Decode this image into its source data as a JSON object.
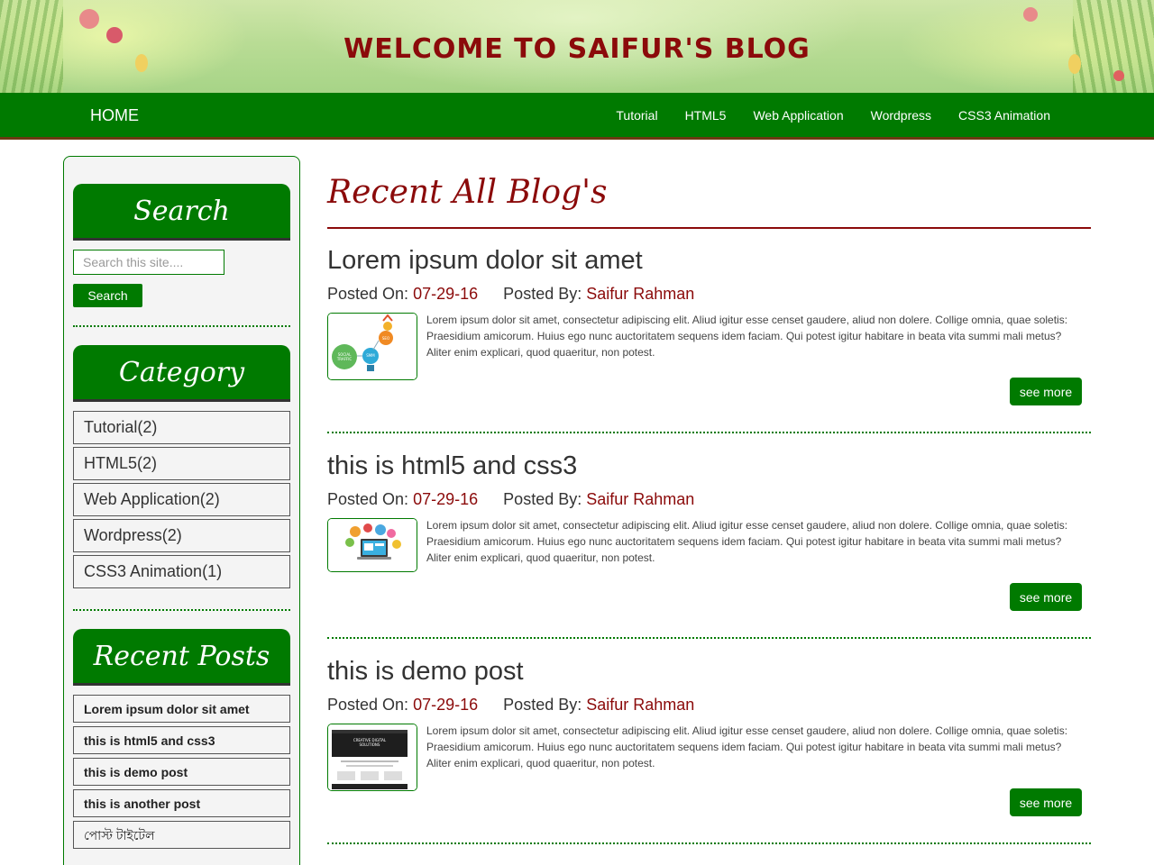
{
  "header": {
    "title": "WELCOME TO SAIFUR'S BLOG"
  },
  "nav": {
    "home": "HOME",
    "links": [
      "Tutorial",
      "HTML5",
      "Web Application",
      "Wordpress",
      "CSS3 Animation"
    ]
  },
  "sidebar": {
    "search": {
      "heading": "Search",
      "placeholder": "Search this site....",
      "button": "Search"
    },
    "category": {
      "heading": "Category",
      "items": [
        "Tutorial(2)",
        "HTML5(2)",
        "Web Application(2)",
        "Wordpress(2)",
        "CSS3 Animation(1)"
      ]
    },
    "recent": {
      "heading": "Recent Posts",
      "items": [
        "Lorem ipsum dolor sit amet",
        "this is html5 and css3",
        "this is demo post",
        "this is another post",
        "পোস্ট টাইটেল"
      ]
    }
  },
  "main": {
    "title": "Recent All Blog's",
    "posted_on_label": "Posted On:",
    "posted_by_label": "Posted By:",
    "see_more": "see more",
    "posts": [
      {
        "title": "Lorem ipsum dolor sit amet",
        "date": "07-29-16",
        "author": "Saifur Rahman",
        "body": "Lorem ipsum dolor sit amet, consectetur adipiscing elit. Aliud igitur esse censet gaudere, aliud non dolere. Collige omnia, quae soletis: Praesidium amicorum. Huius ego nunc auctoritatem sequens idem faciam. Qui potest igitur habitare in beata vita summi mali metus? Aliter enim explicari, quod quaeritur, non potest."
      },
      {
        "title": "this is html5 and css3",
        "date": "07-29-16",
        "author": "Saifur Rahman",
        "body": "Lorem ipsum dolor sit amet, consectetur adipiscing elit. Aliud igitur esse censet gaudere, aliud non dolere. Collige omnia, quae soletis: Praesidium amicorum. Huius ego nunc auctoritatem sequens idem faciam. Qui potest igitur habitare in beata vita summi mali metus? Aliter enim explicari, quod quaeritur, non potest."
      },
      {
        "title": "this is demo post",
        "date": "07-29-16",
        "author": "Saifur Rahman",
        "body": "Lorem ipsum dolor sit amet, consectetur adipiscing elit. Aliud igitur esse censet gaudere, aliud non dolere. Collige omnia, quae soletis: Praesidium amicorum. Huius ego nunc auctoritatem sequens idem faciam. Qui potest igitur habitare in beata vita summi mali metus? Aliter enim explicari, quod quaeritur, non potest."
      }
    ]
  },
  "thumbnails": {
    "post1_text": [
      "SOCIAL",
      "TRAFFIC",
      "SEO",
      "SMM"
    ],
    "post3_text": [
      "CREATIVE DIGITAL",
      "SOLUTIONS"
    ]
  },
  "colors": {
    "brand_green": "#007a00",
    "accent_red": "#8b0a0a",
    "nav_border": "#6b3a12"
  }
}
